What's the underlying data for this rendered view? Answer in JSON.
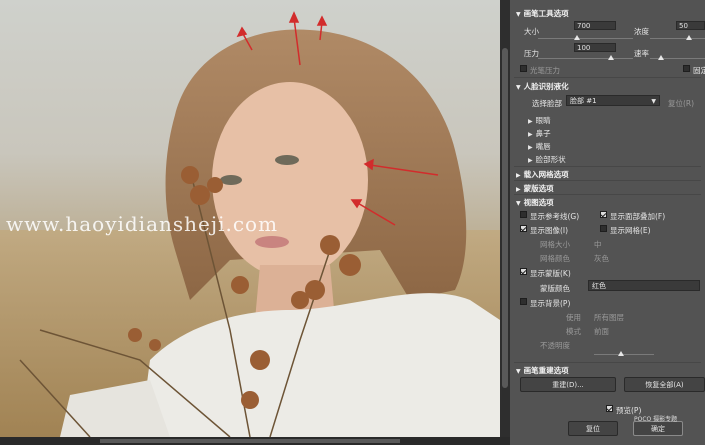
{
  "image": {
    "watermark": "www.haoyidiansheji.com"
  },
  "panel": {
    "face_tool_section": "画笔工具选项",
    "size_label": "大小",
    "size_value": "700",
    "density_label": "浓度",
    "density_value": "50",
    "pressure_label": "压力",
    "pressure_value": "100",
    "rate_label": "速率",
    "stylus_label": "光笔压力",
    "pin_label": "固定",
    "face_aware_section": "人脸识别液化",
    "select_face_label": "选择脸部",
    "select_face_value": "脸部 #1",
    "reset_label": "复位(R)",
    "eyes_label": "眼睛",
    "nose_label": "鼻子",
    "mouth_label": "嘴唇",
    "face_shape_label": "脸部形状",
    "load_mesh_section": "载入网格选项",
    "mask_section": "蒙版选项",
    "view_section": "视图选项",
    "show_guides_label": "显示参考线(G)",
    "show_face_overlay_label": "显示面部叠加(F)",
    "show_image_label": "显示图像(I)",
    "show_mesh_label": "显示网格(E)",
    "mesh_size_label": "网格大小",
    "mesh_size_value": "中",
    "mesh_color_label": "网格颜色",
    "mesh_color_value": "灰色",
    "show_mask_label": "显示蒙版(K)",
    "mask_color_label": "蒙版颜色",
    "mask_color_value": "红色",
    "show_backdrop_label": "显示背景(P)",
    "use_label": "使用",
    "use_value": "所有图层",
    "mode_label": "模式",
    "mode_value": "前面",
    "opacity_label": "不透明度",
    "brush_rebuild_section": "画笔重建选项",
    "rebuild_button": "重建(D)...",
    "restore_all_button": "恢复全部(A)",
    "preview_label": "预览(P)",
    "reset_button": "复位",
    "ok_button": "确定",
    "logo_text": "POCO 摄影专题"
  }
}
